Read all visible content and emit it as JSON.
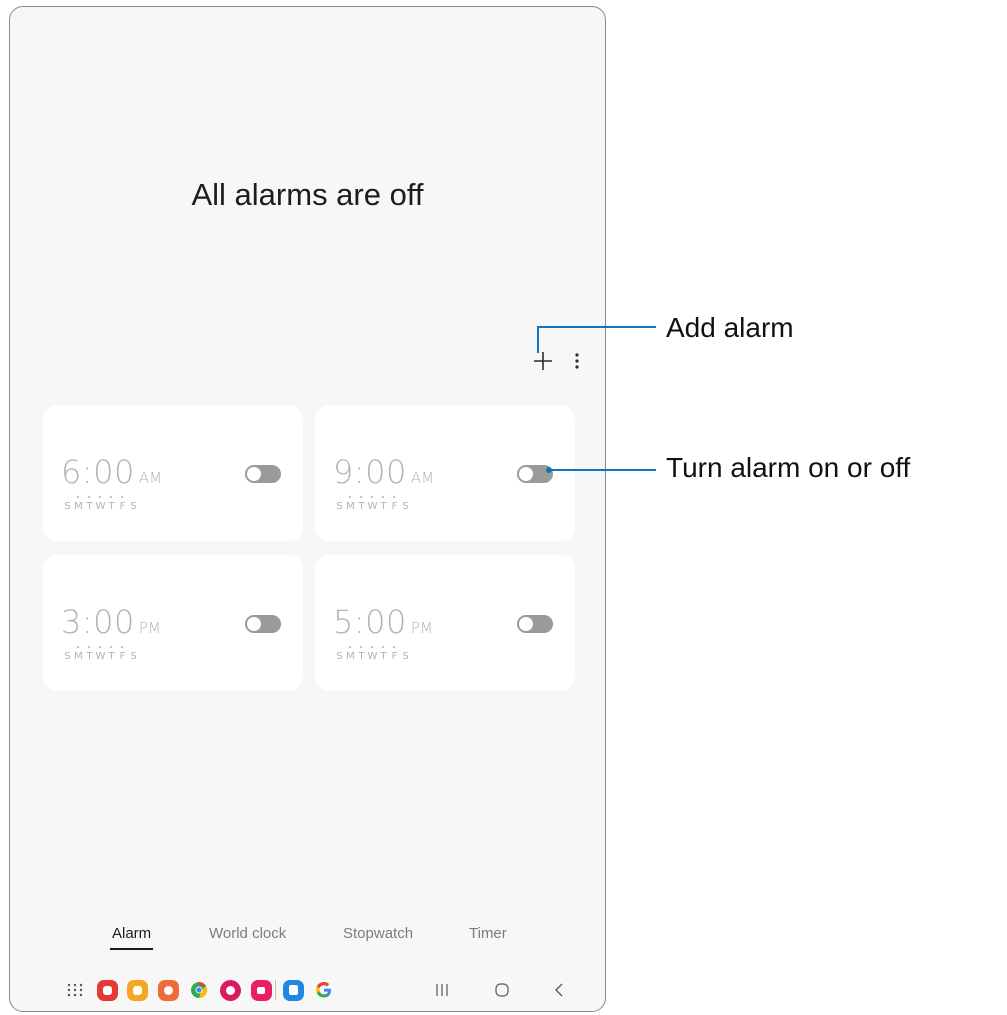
{
  "screen": {
    "title": "All alarms are off"
  },
  "toolbar": {
    "add_icon": "plus-icon",
    "more_icon": "more-vertical-icon"
  },
  "alarms": [
    {
      "hour": "6:00",
      "ampm": "AM",
      "days": [
        "S",
        "M",
        "T",
        "W",
        "T",
        "F",
        "S"
      ],
      "enabled": false
    },
    {
      "hour": "9:00",
      "ampm": "AM",
      "days": [
        "S",
        "M",
        "T",
        "W",
        "T",
        "F",
        "S"
      ],
      "enabled": false
    },
    {
      "hour": "3:00",
      "ampm": "PM",
      "days": [
        "S",
        "M",
        "T",
        "W",
        "T",
        "F",
        "S"
      ],
      "enabled": false
    },
    {
      "hour": "5:00",
      "ampm": "PM",
      "days": [
        "S",
        "M",
        "T",
        "W",
        "T",
        "F",
        "S"
      ],
      "enabled": false
    }
  ],
  "tabs": [
    {
      "label": "Alarm",
      "active": true
    },
    {
      "label": "World clock",
      "active": false
    },
    {
      "label": "Stopwatch",
      "active": false
    },
    {
      "label": "Timer",
      "active": false
    }
  ],
  "dock": {
    "apps": [
      {
        "name": "apps-grid-icon"
      },
      {
        "name": "flipboard-icon",
        "color": "#e53935"
      },
      {
        "name": "my-files-icon",
        "color": "#f5a623"
      },
      {
        "name": "contacts-icon",
        "color": "#ef6c3a"
      },
      {
        "name": "chrome-icon",
        "color": "#34a853"
      },
      {
        "name": "galaxy-store-icon",
        "color": "#d81b60"
      },
      {
        "name": "camera-icon",
        "color": "#e91e63"
      },
      {
        "name": "calendar-icon",
        "color": "#1e88e5"
      },
      {
        "name": "google-icon",
        "color": "#4285f4"
      }
    ],
    "nav": [
      {
        "name": "recents-icon"
      },
      {
        "name": "home-icon"
      },
      {
        "name": "back-icon"
      }
    ]
  },
  "callouts": {
    "add_alarm": "Add alarm",
    "toggle": "Turn alarm on or off"
  },
  "colors": {
    "callout_line": "#1573b8",
    "toggle_off": "#9a9a9a",
    "card_bg": "#ffffff",
    "screen_bg": "#f7f7f7"
  }
}
